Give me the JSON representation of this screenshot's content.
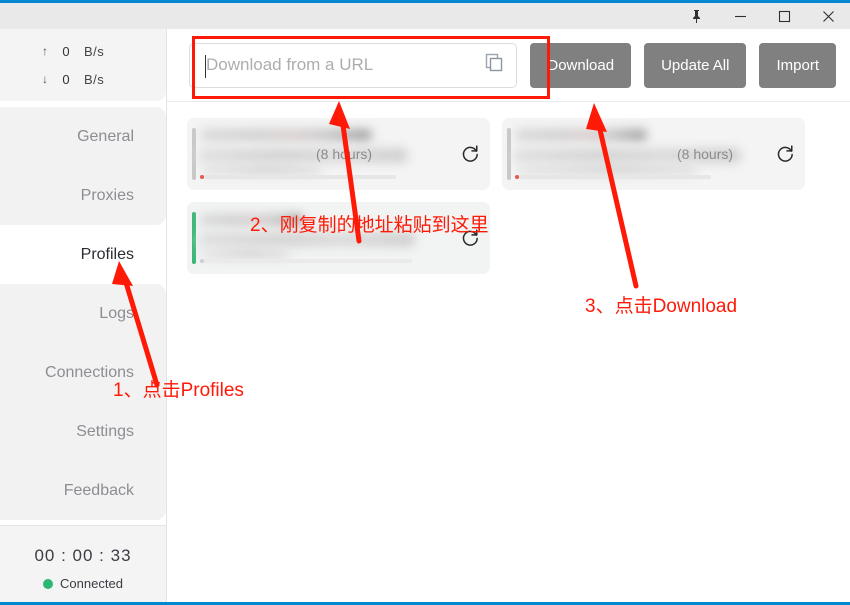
{
  "window": {
    "accent_color": "#0288d1",
    "controls": [
      {
        "name": "pin",
        "glyph": "pin-icon"
      },
      {
        "name": "minimize",
        "glyph": "minimize-icon"
      },
      {
        "name": "maximize",
        "glyph": "maximize-icon"
      },
      {
        "name": "close",
        "glyph": "close-icon"
      }
    ]
  },
  "sidebar": {
    "speed": {
      "upload": {
        "arrow": "↑",
        "value": "0",
        "unit": "B/s"
      },
      "download": {
        "arrow": "↓",
        "value": "0",
        "unit": "B/s"
      }
    },
    "items": [
      {
        "label": "General",
        "active": false
      },
      {
        "label": "Proxies",
        "active": false
      },
      {
        "label": "Profiles",
        "active": true
      },
      {
        "label": "Logs",
        "active": false
      },
      {
        "label": "Connections",
        "active": false
      },
      {
        "label": "Settings",
        "active": false
      },
      {
        "label": "Feedback",
        "active": false
      }
    ],
    "status": {
      "timer": "00 : 00 : 33",
      "connection_label": "Connected",
      "connection_color": "#2bb673"
    }
  },
  "toolbar": {
    "url_placeholder": "Download from a URL",
    "url_value": "",
    "paste_icon": "copy-icon",
    "download_label": "Download",
    "update_all_label": "Update All",
    "import_label": "Import",
    "button_color": "#808080"
  },
  "profiles": {
    "cards": [
      {
        "hours_text": "(8 hours)",
        "selected": false,
        "refresh_icon": "refresh-icon"
      },
      {
        "hours_text": "(8 hours)",
        "selected": false,
        "refresh_icon": "refresh-icon"
      },
      {
        "hours_text": "",
        "selected": true,
        "refresh_icon": "refresh-icon"
      }
    ]
  },
  "annotations": {
    "color": "#ff1a08",
    "step1": "1、点击Profiles",
    "step2": "2、刚复制的地址粘贴到这里",
    "step3": "3、点击Download"
  }
}
